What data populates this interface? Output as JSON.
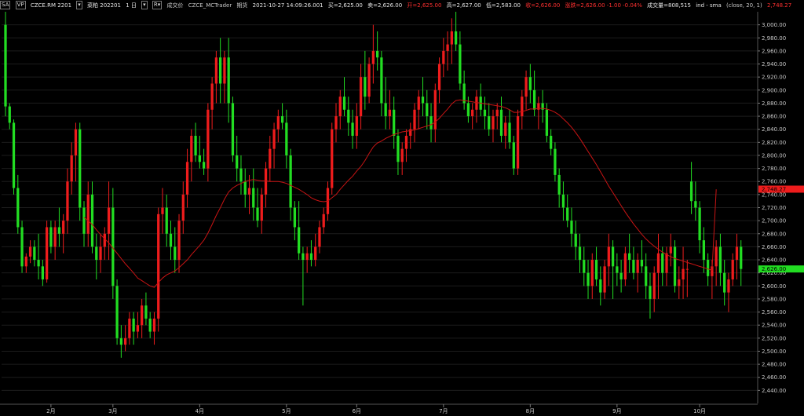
{
  "header": {
    "badge1": "SA",
    "badge2": "VP",
    "exchange_symbol": "CZCE.RM 2201",
    "symbol_name": "菜粕 202201",
    "interval": "1 日",
    "price_type": "成交价",
    "source": "CZCE_MCTrader",
    "futures": "期货",
    "datetime": "2021-10-27  14:09:26.001",
    "bid": "买=2,625.00",
    "ask": "卖=2,626.00",
    "open": "开=2,625.00",
    "high": "高=2,627.00",
    "low": "低=2,583.00",
    "close": "收=2,626.00",
    "change": "涨跌=2,626.00  -1.00   -0.04%",
    "volume": "成交量=808,515",
    "indicator": "ind - sma",
    "indicator_params": "(close,  20,  1)",
    "indicator_value": "2,748.27"
  },
  "colors": {
    "up": "#ee1c1c",
    "down": "#22dd22",
    "sma": "#c81414",
    "grid": "#1c1c1c",
    "axis_text": "#c8c8c8",
    "sma_label_bg": "#ee1c1c",
    "price_label_bg": "#22dd22"
  },
  "chart_data": {
    "type": "candlestick",
    "y_axis": {
      "min": 2420,
      "max": 3020,
      "ticks": [
        "2,440.00",
        "2,460.00",
        "2,480.00",
        "2,500.00",
        "2,520.00",
        "2,540.00",
        "2,560.00",
        "2,580.00",
        "2,600.00",
        "2,620.00",
        "2,640.00",
        "2,660.00",
        "2,680.00",
        "2,700.00",
        "2,720.00",
        "2,740.00",
        "2,760.00",
        "2,780.00",
        "2,800.00",
        "2,820.00",
        "2,840.00",
        "2,860.00",
        "2,880.00",
        "2,900.00",
        "2,920.00",
        "2,940.00",
        "2,960.00",
        "2,980.00",
        "3,000.00"
      ]
    },
    "x_axis": {
      "labels": [
        {
          "text": "2月",
          "index": 11
        },
        {
          "text": "3月",
          "index": 26
        },
        {
          "text": "4月",
          "index": 47
        },
        {
          "text": "5月",
          "index": 68
        },
        {
          "text": "6月",
          "index": 85
        },
        {
          "text": "7月",
          "index": 106
        },
        {
          "text": "8月",
          "index": 127
        },
        {
          "text": "9月",
          "index": 148
        },
        {
          "text": "10月",
          "index": 168
        }
      ]
    },
    "sma_label": "2,748.27",
    "last_price_label": "2,626.00",
    "candles": [
      [
        3000,
        3020,
        2860,
        2875
      ],
      [
        2875,
        2880,
        2840,
        2850
      ],
      [
        2850,
        2855,
        2740,
        2750
      ],
      [
        2750,
        2770,
        2680,
        2690
      ],
      [
        2690,
        2700,
        2620,
        2630
      ],
      [
        2630,
        2650,
        2620,
        2645
      ],
      [
        2645,
        2670,
        2635,
        2660
      ],
      [
        2660,
        2670,
        2630,
        2640
      ],
      [
        2640,
        2680,
        2610,
        2630
      ],
      [
        2630,
        2640,
        2600,
        2610
      ],
      [
        2610,
        2700,
        2605,
        2690
      ],
      [
        2690,
        2700,
        2650,
        2660
      ],
      [
        2660,
        2700,
        2640,
        2690
      ],
      [
        2690,
        2720,
        2660,
        2680
      ],
      [
        2680,
        2710,
        2650,
        2700
      ],
      [
        2700,
        2780,
        2680,
        2760
      ],
      [
        2760,
        2820,
        2740,
        2800
      ],
      [
        2800,
        2850,
        2760,
        2840
      ],
      [
        2840,
        2850,
        2700,
        2720
      ],
      [
        2720,
        2730,
        2660,
        2680
      ],
      [
        2680,
        2760,
        2660,
        2740
      ],
      [
        2740,
        2760,
        2650,
        2660
      ],
      [
        2660,
        2680,
        2610,
        2640
      ],
      [
        2640,
        2680,
        2620,
        2660
      ],
      [
        2660,
        2690,
        2640,
        2680
      ],
      [
        2680,
        2760,
        2640,
        2720
      ],
      [
        2720,
        2750,
        2580,
        2600
      ],
      [
        2600,
        2610,
        2510,
        2520
      ],
      [
        2520,
        2540,
        2490,
        2510
      ],
      [
        2510,
        2540,
        2500,
        2520
      ],
      [
        2520,
        2560,
        2510,
        2550
      ],
      [
        2550,
        2560,
        2510,
        2530
      ],
      [
        2530,
        2560,
        2520,
        2540
      ],
      [
        2540,
        2580,
        2520,
        2570
      ],
      [
        2570,
        2590,
        2540,
        2550
      ],
      [
        2550,
        2560,
        2520,
        2530
      ],
      [
        2530,
        2560,
        2510,
        2550
      ],
      [
        2550,
        2720,
        2530,
        2710
      ],
      [
        2710,
        2750,
        2680,
        2720
      ],
      [
        2720,
        2740,
        2660,
        2680
      ],
      [
        2680,
        2700,
        2640,
        2660
      ],
      [
        2660,
        2690,
        2620,
        2640
      ],
      [
        2640,
        2710,
        2620,
        2700
      ],
      [
        2700,
        2760,
        2680,
        2740
      ],
      [
        2740,
        2810,
        2720,
        2790
      ],
      [
        2790,
        2840,
        2760,
        2830
      ],
      [
        2830,
        2850,
        2790,
        2800
      ],
      [
        2800,
        2830,
        2780,
        2790
      ],
      [
        2790,
        2810,
        2770,
        2780
      ],
      [
        2780,
        2880,
        2760,
        2870
      ],
      [
        2870,
        2920,
        2840,
        2910
      ],
      [
        2910,
        2960,
        2880,
        2950
      ],
      [
        2950,
        2980,
        2880,
        2910
      ],
      [
        2910,
        2960,
        2880,
        2950
      ],
      [
        2950,
        2980,
        2850,
        2880
      ],
      [
        2880,
        2890,
        2790,
        2800
      ],
      [
        2800,
        2830,
        2760,
        2780
      ],
      [
        2780,
        2800,
        2740,
        2760
      ],
      [
        2760,
        2780,
        2720,
        2740
      ],
      [
        2740,
        2770,
        2710,
        2750
      ],
      [
        2750,
        2780,
        2700,
        2720
      ],
      [
        2720,
        2750,
        2690,
        2700
      ],
      [
        2700,
        2750,
        2680,
        2740
      ],
      [
        2740,
        2790,
        2720,
        2780
      ],
      [
        2780,
        2830,
        2760,
        2810
      ],
      [
        2810,
        2850,
        2780,
        2840
      ],
      [
        2840,
        2870,
        2820,
        2860
      ],
      [
        2860,
        2880,
        2840,
        2850
      ],
      [
        2850,
        2870,
        2780,
        2800
      ],
      [
        2800,
        2810,
        2700,
        2720
      ],
      [
        2720,
        2730,
        2670,
        2690
      ],
      [
        2690,
        2730,
        2640,
        2650
      ],
      [
        2650,
        2660,
        2570,
        2640
      ],
      [
        2640,
        2660,
        2620,
        2650
      ],
      [
        2650,
        2670,
        2630,
        2640
      ],
      [
        2640,
        2680,
        2630,
        2660
      ],
      [
        2660,
        2700,
        2650,
        2690
      ],
      [
        2690,
        2720,
        2680,
        2710
      ],
      [
        2710,
        2760,
        2700,
        2750
      ],
      [
        2750,
        2850,
        2740,
        2840
      ],
      [
        2840,
        2880,
        2820,
        2860
      ],
      [
        2860,
        2900,
        2840,
        2890
      ],
      [
        2890,
        2920,
        2860,
        2870
      ],
      [
        2870,
        2890,
        2830,
        2850
      ],
      [
        2850,
        2870,
        2810,
        2830
      ],
      [
        2830,
        2880,
        2810,
        2860
      ],
      [
        2860,
        2940,
        2840,
        2920
      ],
      [
        2920,
        2960,
        2870,
        2890
      ],
      [
        2890,
        2950,
        2880,
        2940
      ],
      [
        2940,
        3000,
        2910,
        2960
      ],
      [
        2960,
        2990,
        2930,
        2950
      ],
      [
        2950,
        2960,
        2860,
        2880
      ],
      [
        2880,
        2920,
        2840,
        2860
      ],
      [
        2860,
        2900,
        2840,
        2870
      ],
      [
        2870,
        2890,
        2810,
        2830
      ],
      [
        2830,
        2840,
        2770,
        2790
      ],
      [
        2790,
        2820,
        2770,
        2810
      ],
      [
        2810,
        2840,
        2790,
        2830
      ],
      [
        2830,
        2850,
        2810,
        2840
      ],
      [
        2840,
        2880,
        2820,
        2870
      ],
      [
        2870,
        2900,
        2840,
        2890
      ],
      [
        2890,
        2920,
        2860,
        2880
      ],
      [
        2880,
        2900,
        2840,
        2860
      ],
      [
        2860,
        2880,
        2820,
        2840
      ],
      [
        2840,
        2910,
        2820,
        2900
      ],
      [
        2900,
        2950,
        2880,
        2940
      ],
      [
        2940,
        2980,
        2920,
        2960
      ],
      [
        2960,
        2990,
        2930,
        2970
      ],
      [
        2970,
        3010,
        2940,
        2990
      ],
      [
        2990,
        3020,
        2960,
        2970
      ],
      [
        2970,
        2990,
        2900,
        2910
      ],
      [
        2910,
        2930,
        2870,
        2880
      ],
      [
        2880,
        2890,
        2850,
        2860
      ],
      [
        2860,
        2880,
        2840,
        2870
      ],
      [
        2870,
        2900,
        2850,
        2890
      ],
      [
        2890,
        2910,
        2860,
        2870
      ],
      [
        2870,
        2890,
        2840,
        2860
      ],
      [
        2860,
        2880,
        2830,
        2840
      ],
      [
        2840,
        2870,
        2820,
        2860
      ],
      [
        2860,
        2880,
        2840,
        2870
      ],
      [
        2870,
        2890,
        2820,
        2830
      ],
      [
        2830,
        2860,
        2810,
        2850
      ],
      [
        2850,
        2870,
        2810,
        2820
      ],
      [
        2820,
        2830,
        2770,
        2780
      ],
      [
        2780,
        2870,
        2770,
        2860
      ],
      [
        2860,
        2900,
        2840,
        2890
      ],
      [
        2890,
        2930,
        2870,
        2920
      ],
      [
        2920,
        2940,
        2880,
        2900
      ],
      [
        2900,
        2930,
        2860,
        2870
      ],
      [
        2870,
        2890,
        2840,
        2880
      ],
      [
        2880,
        2900,
        2850,
        2870
      ],
      [
        2870,
        2880,
        2820,
        2830
      ],
      [
        2830,
        2840,
        2800,
        2810
      ],
      [
        2810,
        2820,
        2760,
        2770
      ],
      [
        2770,
        2780,
        2720,
        2740
      ],
      [
        2740,
        2760,
        2700,
        2720
      ],
      [
        2720,
        2740,
        2690,
        2700
      ],
      [
        2700,
        2720,
        2660,
        2680
      ],
      [
        2680,
        2700,
        2640,
        2660
      ],
      [
        2660,
        2680,
        2620,
        2640
      ],
      [
        2640,
        2660,
        2600,
        2620
      ],
      [
        2620,
        2640,
        2580,
        2600
      ],
      [
        2600,
        2650,
        2580,
        2640
      ],
      [
        2640,
        2660,
        2600,
        2610
      ],
      [
        2610,
        2630,
        2570,
        2590
      ],
      [
        2590,
        2640,
        2580,
        2630
      ],
      [
        2630,
        2680,
        2600,
        2660
      ],
      [
        2660,
        2670,
        2580,
        2630
      ],
      [
        2630,
        2650,
        2600,
        2620
      ],
      [
        2620,
        2640,
        2590,
        2610
      ],
      [
        2610,
        2660,
        2600,
        2650
      ],
      [
        2650,
        2680,
        2620,
        2640
      ],
      [
        2640,
        2660,
        2610,
        2620
      ],
      [
        2620,
        2650,
        2590,
        2640
      ],
      [
        2640,
        2670,
        2620,
        2630
      ],
      [
        2630,
        2650,
        2580,
        2600
      ],
      [
        2600,
        2620,
        2550,
        2580
      ],
      [
        2580,
        2630,
        2560,
        2620
      ],
      [
        2620,
        2680,
        2580,
        2650
      ],
      [
        2650,
        2660,
        2600,
        2620
      ],
      [
        2620,
        2660,
        2600,
        2650
      ],
      [
        2650,
        2680,
        2630,
        2660
      ],
      [
        2660,
        2670,
        2590,
        2600
      ],
      [
        2600,
        2630,
        2580,
        2610
      ],
      [
        2610,
        2660,
        2580,
        2626
      ],
      [
        2626,
        2640,
        2583,
        2626
      ],
      [
        2760,
        2790,
        2710,
        2730
      ],
      [
        2730,
        2760,
        2700,
        2720
      ],
      [
        2720,
        2730,
        2650,
        2670
      ],
      [
        2670,
        2690,
        2620,
        2640
      ],
      [
        2640,
        2650,
        2600,
        2615
      ],
      [
        2615,
        2640,
        2580,
        2630
      ],
      [
        2630,
        2670,
        2600,
        2660
      ],
      [
        2660,
        2680,
        2600,
        2620
      ],
      [
        2620,
        2640,
        2570,
        2590
      ],
      [
        2590,
        2620,
        2560,
        2610
      ],
      [
        2610,
        2650,
        2600,
        2640
      ],
      [
        2640,
        2680,
        2610,
        2660
      ],
      [
        2660,
        2670,
        2600,
        2626
      ]
    ],
    "sma": [
      null,
      null,
      null,
      null,
      null,
      null,
      null,
      null,
      null,
      null,
      null,
      null,
      null,
      null,
      null,
      null,
      null,
      null,
      null,
      2705,
      2700,
      2694,
      2686,
      2679,
      2672,
      2666,
      2658,
      2650,
      2642,
      2634,
      2627,
      2620,
      2612,
      2608,
      2604,
      2600,
      2598,
      2605,
      2612,
      2617,
      2620,
      2623,
      2628,
      2634,
      2640,
      2648,
      2655,
      2662,
      2670,
      2681,
      2694,
      2708,
      2720,
      2733,
      2744,
      2750,
      2754,
      2757,
      2760,
      2762,
      2763,
      2762,
      2761,
      2761,
      2760,
      2760,
      2760,
      2759,
      2757,
      2754,
      2751,
      2748,
      2744,
      2740,
      2735,
      2732,
      2730,
      2729,
      2730,
      2735,
      2740,
      2748,
      2755,
      2762,
      2768,
      2776,
      2783,
      2792,
      2803,
      2813,
      2819,
      2822,
      2826,
      2829,
      2832,
      2834,
      2836,
      2837,
      2838,
      2839,
      2841,
      2843,
      2845,
      2847,
      2851,
      2857,
      2864,
      2871,
      2879,
      2884,
      2885,
      2884,
      2883,
      2882,
      2881,
      2880,
      2879,
      2878,
      2877,
      2876,
      2875,
      2873,
      2870,
      2866,
      2866,
      2867,
      2869,
      2871,
      2871,
      2872,
      2872,
      2871,
      2869,
      2866,
      2862,
      2856,
      2850,
      2843,
      2835,
      2826,
      2816,
      2806,
      2796,
      2786,
      2775,
      2764,
      2753,
      2743,
      2733,
      2723,
      2713,
      2704,
      2695,
      2687,
      2679,
      2672,
      2666,
      2661,
      2656,
      2652,
      2648,
      2645,
      2642,
      2640,
      2638,
      2636,
      2634,
      2632,
      2630,
      2628,
      2626,
      2624,
      2748
    ]
  }
}
